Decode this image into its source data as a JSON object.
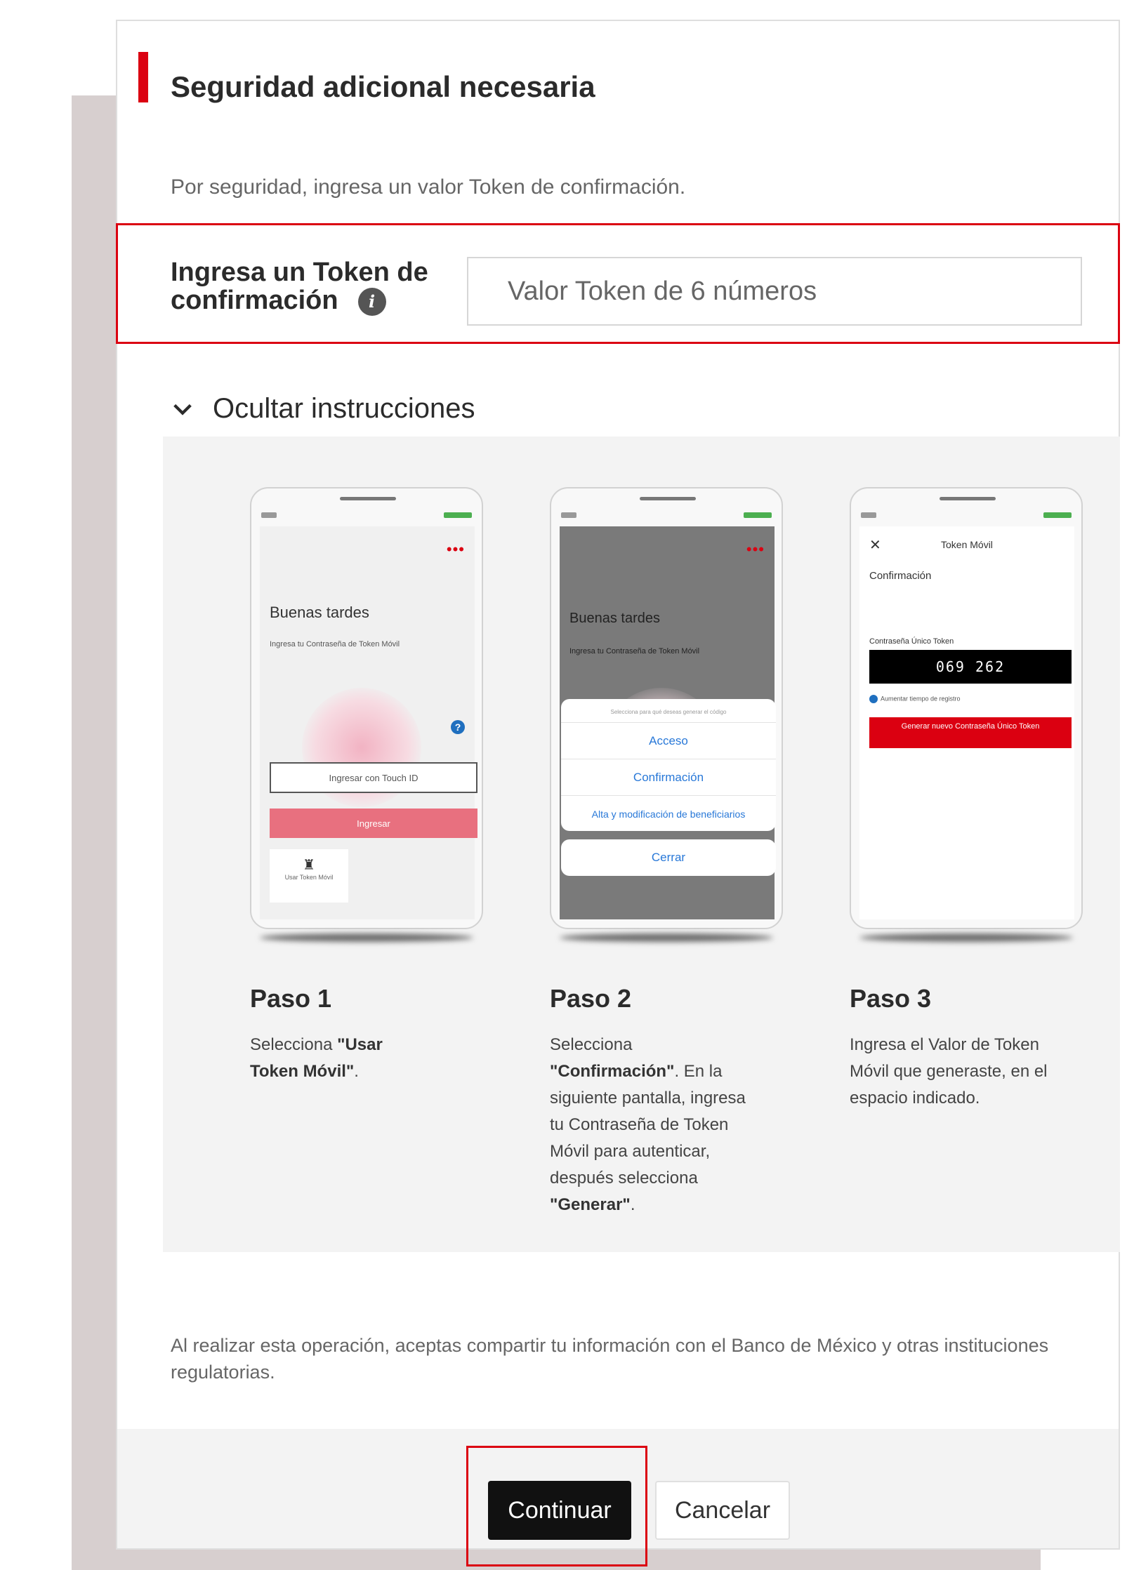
{
  "title": "Seguridad adicional necesaria",
  "subtitle": "Por seguridad, ingresa un valor Token de confirmación.",
  "token": {
    "label": "Ingresa un Token de confirmación",
    "placeholder": "Valor Token de 6 números"
  },
  "instructions_toggle": "Ocultar instrucciones",
  "phones": {
    "p1": {
      "greeting": "Buenas tardes",
      "prompt": "Ingresa tu Contraseña de Token Móvil",
      "input_label": "Ingresar con Touch ID",
      "button_label": "Ingresar",
      "tile_label": "Usar Token Móvil"
    },
    "p2": {
      "greeting": "Buenas tardes",
      "prompt": "Ingresa tu Contraseña de Token Móvil",
      "sheet_header": "Selecciona para qué deseas generar el código",
      "options": [
        "Acceso",
        "Confirmación",
        "Alta y modificación de beneficiarios"
      ],
      "cancel": "Cerrar"
    },
    "p3": {
      "nav_title": "Token Móvil",
      "heading": "Confirmación",
      "code_label": "Contraseña Único Token",
      "code": "069 262",
      "info_text": "Aumentar tiempo de registro",
      "red_button": "Generar nuevo Contraseña Único Token"
    }
  },
  "steps": [
    {
      "title": "Paso 1",
      "pre": "Selecciona ",
      "bold": "\"Usar Token Móvil\"",
      "post": "."
    },
    {
      "title": "Paso 2",
      "pre": "Selecciona ",
      "bold": "\"Confirmación\"",
      "post": ". En la siguiente pantalla, ingresa tu Contraseña de Token Móvil para autenticar, después selecciona ",
      "bold2": "\"Generar\"",
      "post2": "."
    },
    {
      "title": "Paso 3",
      "text": "Ingresa el Valor de Token Móvil que generaste, en el espacio indicado."
    }
  ],
  "footer_note": "Al realizar esta operación, aceptas compartir tu información con el Banco de México y otras instituciones regulatorias.",
  "buttons": {
    "continue": "Continuar",
    "cancel": "Cancelar"
  },
  "colors": {
    "accent": "#db0011",
    "primary_button": "#111111",
    "link_blue": "#2878d8"
  }
}
